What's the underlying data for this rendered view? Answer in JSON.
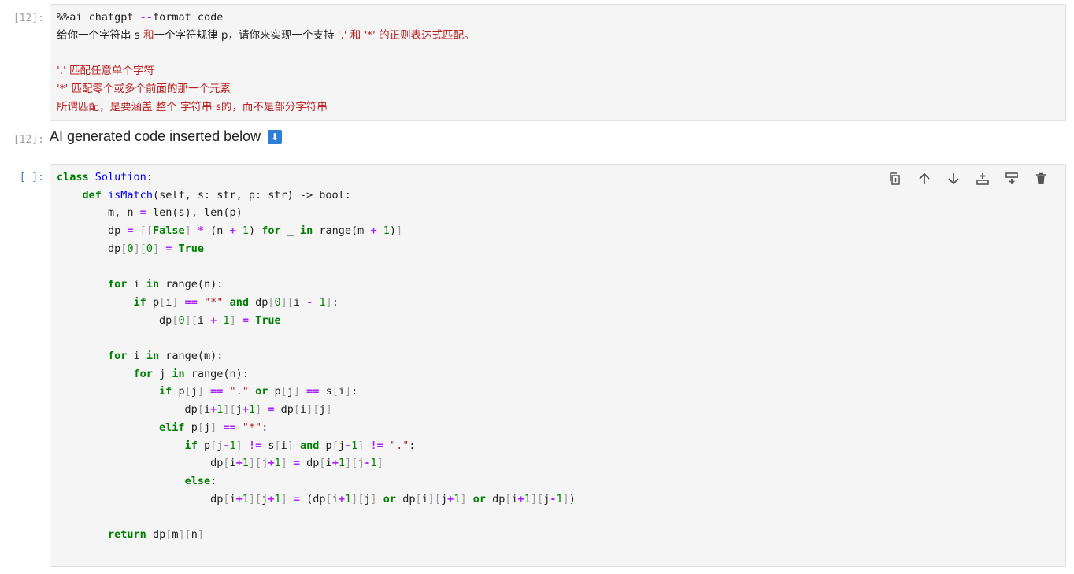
{
  "cell1": {
    "prompt": "[12]:",
    "lines": [
      "%%ai chatgpt --format code",
      "给你一个字符串 s 和一个字符规律 p，请你来实现一个支持 '.' 和 '*' 的正则表达式匹配。",
      "",
      "'.' 匹配任意单个字符",
      "'*' 匹配零个或多个前面的那一个元素",
      "所谓匹配，是要涵盖 整个 字符串 s的，而不是部分字符串"
    ]
  },
  "output1": {
    "prompt": "[12]:",
    "text": "AI generated code inserted below",
    "badge": "⬇"
  },
  "cell2": {
    "prompt": "[ ]:",
    "toolbar": {
      "icons": [
        "duplicate-icon",
        "move-up-icon",
        "move-down-icon",
        "insert-above-icon",
        "insert-below-icon",
        "delete-icon"
      ]
    },
    "code_lines": [
      "class Solution:",
      "    def isMatch(self, s: str, p: str) -> bool:",
      "        m, n = len(s), len(p)",
      "        dp = [[False] * (n + 1) for _ in range(m + 1)]",
      "        dp[0][0] = True",
      "",
      "        for i in range(n):",
      "            if p[i] == \"*\" and dp[0][i - 1]:",
      "                dp[0][i + 1] = True",
      "",
      "        for i in range(m):",
      "            for j in range(n):",
      "                if p[j] == \".\" or p[j] == s[i]:",
      "                    dp[i+1][j+1] = dp[i][j]",
      "                elif p[j] == \"*\":",
      "                    if p[j-1] != s[i] and p[j-1] != \".\":",
      "                        dp[i+1][j+1] = dp[i+1][j-1]",
      "                    else:",
      "                        dp[i+1][j+1] = (dp[i+1][j] or dp[i][j+1] or dp[i+1][j-1])",
      "",
      "        return dp[m][n]"
    ]
  },
  "colors": {
    "keyword": "#008000",
    "operator": "#aa22ff",
    "function": "#0000ff",
    "string": "#ba2121",
    "prompt_in": "#307fc1",
    "prompt_out": "#9e9e9e"
  }
}
